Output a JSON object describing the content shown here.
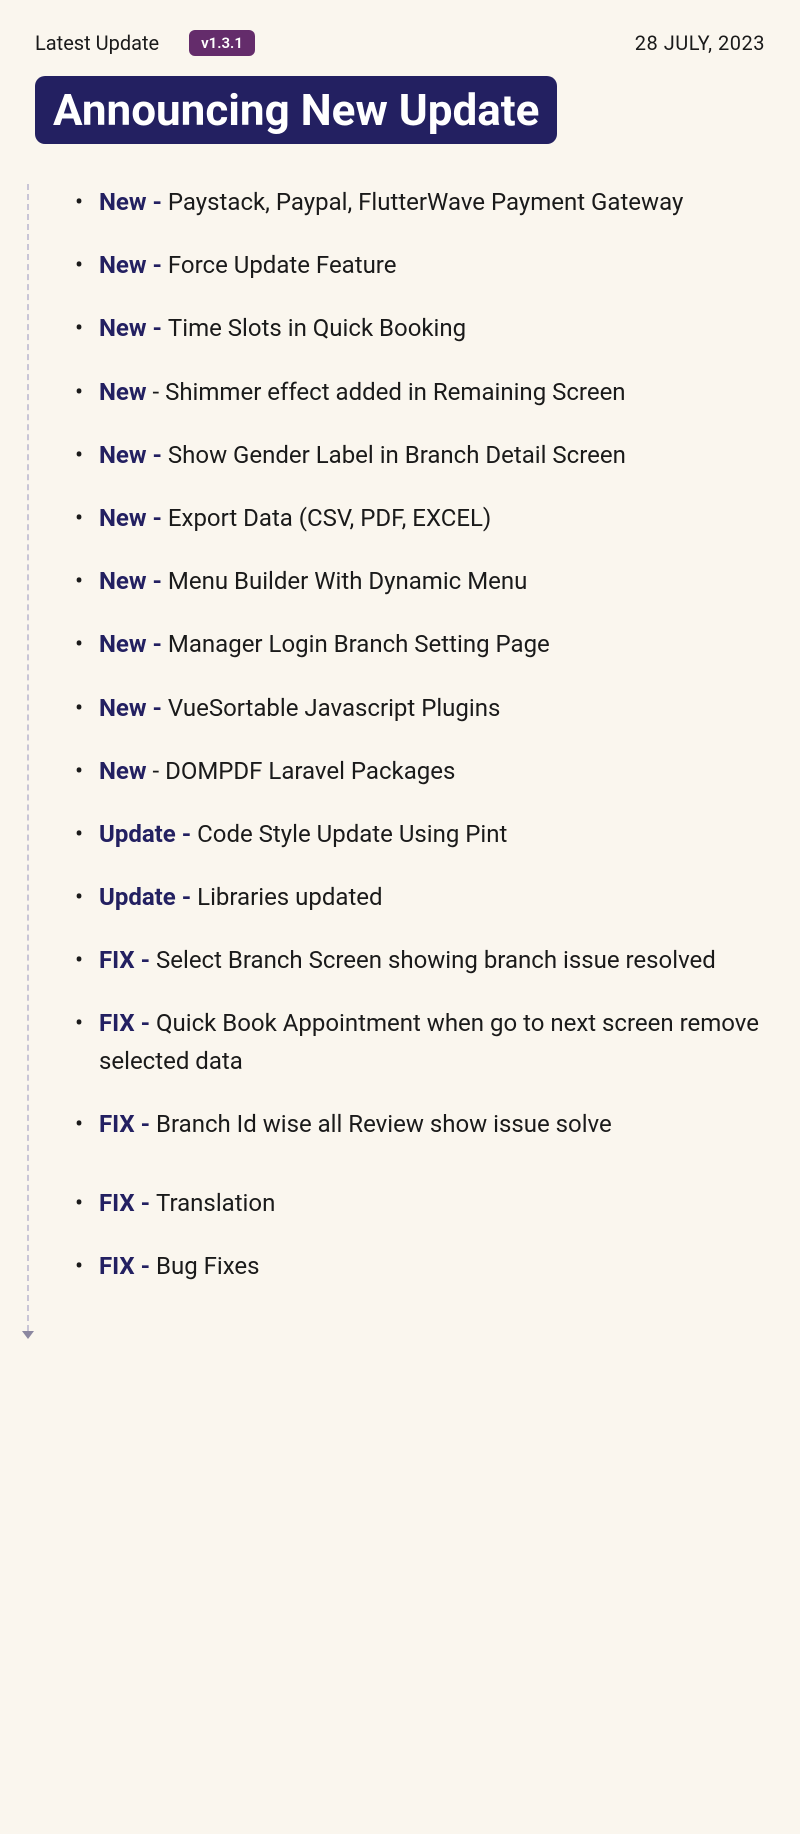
{
  "header": {
    "latest_label": "Latest Update",
    "version": "v1.3.1",
    "date": "28 JULY, 2023"
  },
  "title": "Announcing New Update",
  "items": [
    {
      "tag": "New - ",
      "text": "Paystack, Paypal, FlutterWave Payment Gateway"
    },
    {
      "tag": "New - ",
      "text": "Force Update Feature"
    },
    {
      "tag": "New - ",
      "text": "Time Slots in Quick Booking"
    },
    {
      "tag": "New",
      "text": " - Shimmer effect added in Remaining Screen"
    },
    {
      "tag": "New - ",
      "text": "Show Gender Label in Branch Detail Screen"
    },
    {
      "tag": "New - ",
      "text": "Export Data (CSV, PDF, EXCEL)"
    },
    {
      "tag": "New - ",
      "text": "Menu Builder With Dynamic Menu"
    },
    {
      "tag": "New - ",
      "text": "Manager Login Branch Setting Page"
    },
    {
      "tag": "New - ",
      "text": "VueSortable Javascript Plugins"
    },
    {
      "tag": "New",
      "text": " - DOMPDF Laravel Packages"
    },
    {
      "tag": "Update - ",
      "text": "Code Style Update Using Pint"
    },
    {
      "tag": "Update - ",
      "text": "Libraries updated"
    },
    {
      "tag": "FIX - ",
      "text": "Select Branch Screen showing branch issue resolved"
    },
    {
      "tag": "FIX - ",
      "text": "Quick Book Appointment when go to next screen remove selected data"
    },
    {
      "tag": "FIX - ",
      "text": "Branch Id wise all Review show issue solve"
    },
    {
      "tag": "FIX - ",
      "text": "Translation",
      "extra_gap": true
    },
    {
      "tag": "FIX - ",
      "text": "Bug Fixes"
    }
  ]
}
